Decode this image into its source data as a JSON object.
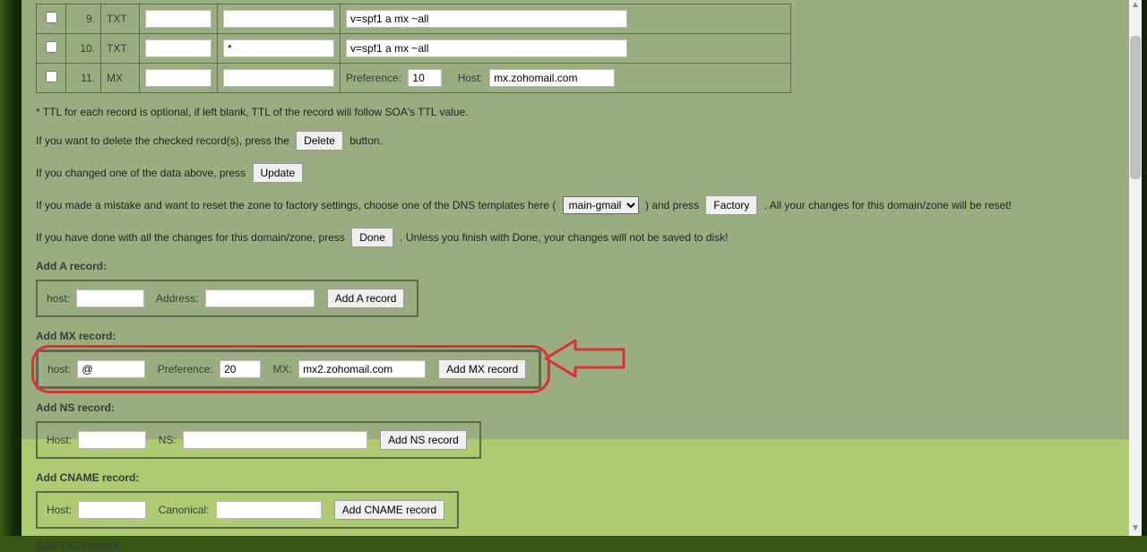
{
  "records": [
    {
      "n": "9.",
      "type": "TXT",
      "colA": "",
      "colB": "",
      "value_long": "v=spf1 a mx ~all"
    },
    {
      "n": "10.",
      "type": "TXT",
      "colA": "",
      "colB": "*",
      "value_long": "v=spf1 a mx ~all"
    },
    {
      "n": "11.",
      "type": "MX",
      "colA": "",
      "colB": "",
      "mx": {
        "pref_label": "Preference:",
        "pref": "10",
        "host_label": "Host:",
        "host": "mx.zohomail.com"
      }
    }
  ],
  "notes": {
    "ttl": "* TTL for each record is optional, if left blank, TTL of the record will follow SOA's TTL value.",
    "delete_pre": "If you want to delete the checked record(s), press the",
    "delete_btn": "Delete",
    "delete_post": " button.",
    "update_pre": "If you changed one of the data above, press",
    "update_btn": "Update",
    "factory_pre": "If you made a mistake and want to reset the zone to factory settings, choose one of the DNS templates here (",
    "factory_select": "main-gmail",
    "factory_mid": ") and press",
    "factory_btn": "Factory",
    "factory_post": ". All your changes for this domain/zone will be reset!",
    "done_pre": "If you have done with all the changes for this domain/zone, press",
    "done_btn": "Done",
    "done_post": ". Unless you finish with Done, your changes will not be saved to disk!"
  },
  "addA": {
    "title": "Add A record:",
    "host_label": "host:",
    "host": "",
    "addr_label": "Address:",
    "addr": "",
    "btn": "Add A record"
  },
  "addMX": {
    "title": "Add MX record:",
    "host_label": "host:",
    "host": "@",
    "pref_label": "Preference:",
    "pref": "20",
    "mx_label": "MX:",
    "mx": "mx2.zohomail.com",
    "btn": "Add MX record"
  },
  "addNS": {
    "title": "Add NS record:",
    "host_label": "Host:",
    "host": "",
    "ns_label": "NS:",
    "ns": "",
    "btn": "Add NS record"
  },
  "addCNAME": {
    "title": "Add CNAME record:",
    "host_label": "Host:",
    "host": "",
    "canon_label": "Canonical:",
    "canon": "",
    "btn": "Add CNAME record"
  },
  "addTXT": {
    "title": "Add TXT record:"
  }
}
